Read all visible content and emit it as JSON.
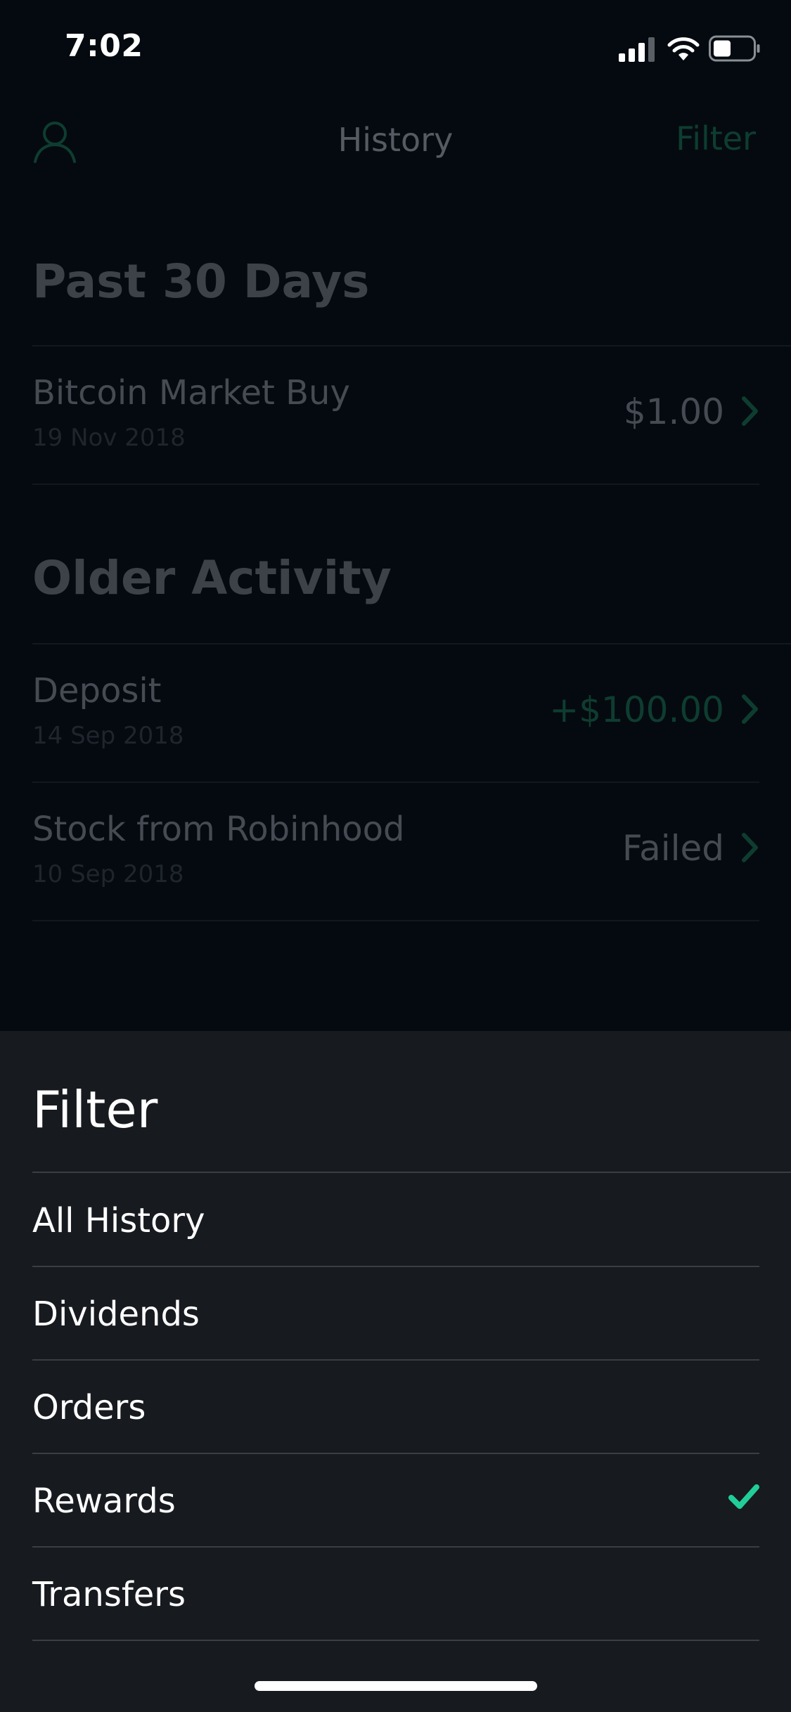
{
  "status_bar": {
    "time": "7:02",
    "icons": [
      "signal-icon",
      "wifi-icon",
      "battery-icon"
    ]
  },
  "nav": {
    "title": "History",
    "filter_label": "Filter",
    "profile_icon": "profile-icon"
  },
  "sections": [
    {
      "heading": "Past 30 Days",
      "items": [
        {
          "title": "Bitcoin Market Buy",
          "date": "19 Nov 2018",
          "amount": "$1.00"
        }
      ]
    },
    {
      "heading": "Older Activity",
      "items": [
        {
          "title": "Deposit",
          "date": "14 Sep 2018",
          "amount": "+$100.00"
        },
        {
          "title": "Stock from Robinhood",
          "date": "10 Sep 2018",
          "amount": "Failed"
        }
      ]
    }
  ],
  "filter_sheet": {
    "title": "Filter",
    "options": [
      {
        "label": "All History",
        "selected": false
      },
      {
        "label": "Dividends",
        "selected": false
      },
      {
        "label": "Orders",
        "selected": false
      },
      {
        "label": "Rewards",
        "selected": true
      },
      {
        "label": "Transfers",
        "selected": false
      }
    ]
  },
  "colors": {
    "background": "#050a10",
    "sheet_background": "#171a1f",
    "accent_green": "#21ce99"
  }
}
